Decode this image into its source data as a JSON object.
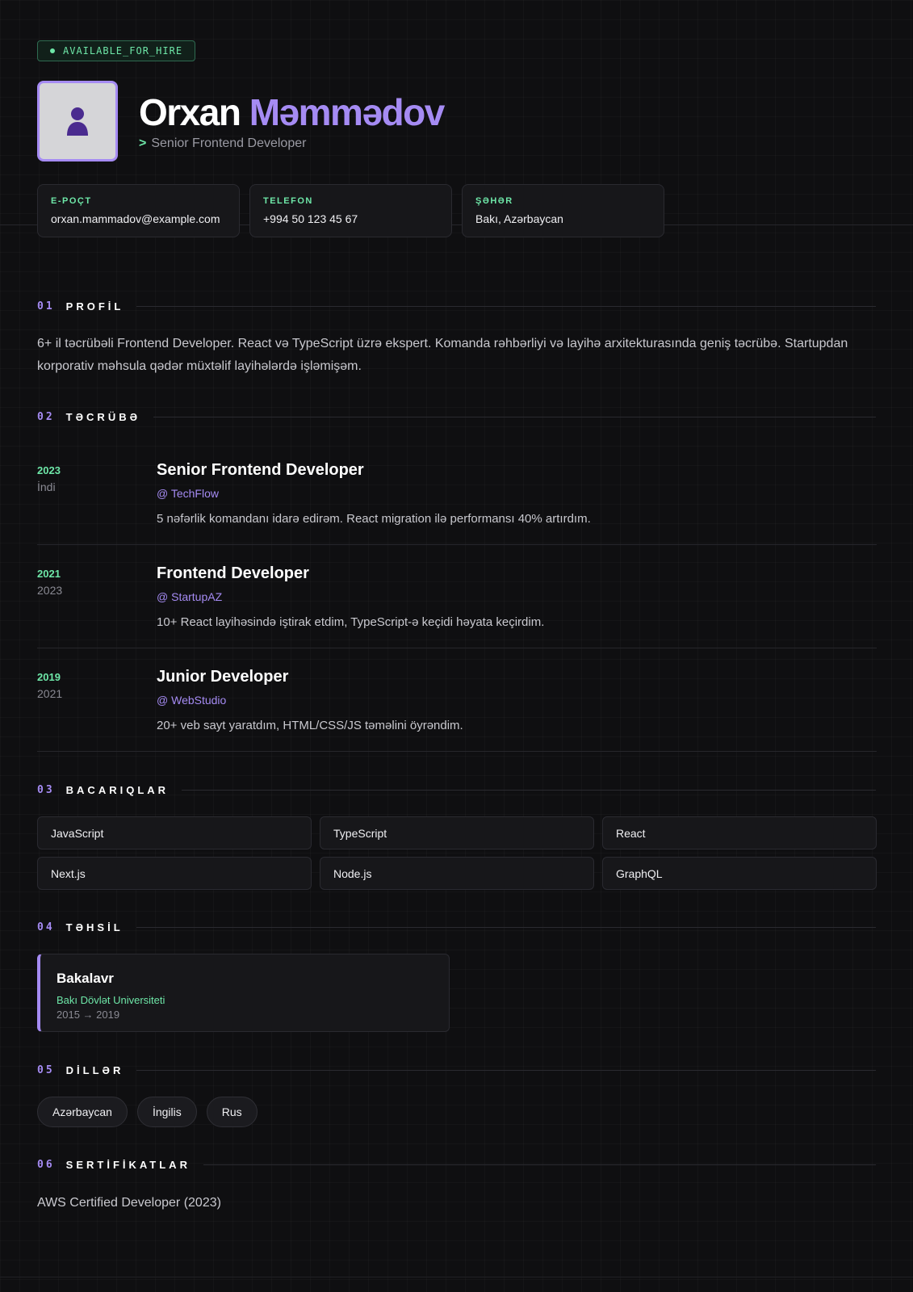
{
  "header": {
    "badge": "AVAILABLE_FOR_HIRE",
    "first_name": "Orxan",
    "last_name": "Məmmədov",
    "role_prefix": ">",
    "role": "Senior Frontend Developer",
    "avatar_icon": "user-icon"
  },
  "contacts": [
    {
      "label": "E-POÇT",
      "value": "orxan.mammadov@example.com"
    },
    {
      "label": "TELEFON",
      "value": "+994 50 123 45 67"
    },
    {
      "label": "ŞƏHƏR",
      "value": "Bakı, Azərbaycan"
    }
  ],
  "sections": [
    {
      "num": "01",
      "title": "PROFİL"
    },
    {
      "num": "02",
      "title": "TƏCRÜBƏ"
    },
    {
      "num": "03",
      "title": "BACARIQLAR"
    },
    {
      "num": "04",
      "title": "TƏHSİL"
    },
    {
      "num": "05",
      "title": "DİLLƏR"
    },
    {
      "num": "06",
      "title": "SERTİFİKATLAR"
    }
  ],
  "profile": "6+ il təcrübəli Frontend Developer. React və TypeScript üzrə ekspert. Komanda rəhbərliyi və layihə arxitekturasında geniş təcrübə. Startupdan korporativ məhsula qədər müxtəlif layihələrdə işləmişəm.",
  "experience": [
    {
      "start": "2023",
      "end": "İndi",
      "title": "Senior Frontend Developer",
      "company": "@ TechFlow",
      "desc": "5 nəfərlik komandanı idarə edirəm. React migration ilə performansı 40% artırdım."
    },
    {
      "start": "2021",
      "end": "2023",
      "title": "Frontend Developer",
      "company": "@ StartupAZ",
      "desc": "10+ React layihəsində iştirak etdim, TypeScript-ə keçidi həyata keçirdim."
    },
    {
      "start": "2019",
      "end": "2021",
      "title": "Junior Developer",
      "company": "@ WebStudio",
      "desc": "20+ veb sayt yaratdım, HTML/CSS/JS təməlini öyrəndim."
    }
  ],
  "skills": [
    "JavaScript",
    "TypeScript",
    "React",
    "Next.js",
    "Node.js",
    "GraphQL"
  ],
  "education": {
    "degree": "Bakalavr",
    "school": "Bakı Dövlət Universiteti",
    "years": "2015 → 2019"
  },
  "languages": [
    "Azərbaycan",
    "İngilis",
    "Rus"
  ],
  "certificates": [
    "AWS Certified Developer (2023)"
  ],
  "colors": {
    "accent": "#a58bf3",
    "green": "#6ee7a8",
    "background": "#0f0f11"
  }
}
